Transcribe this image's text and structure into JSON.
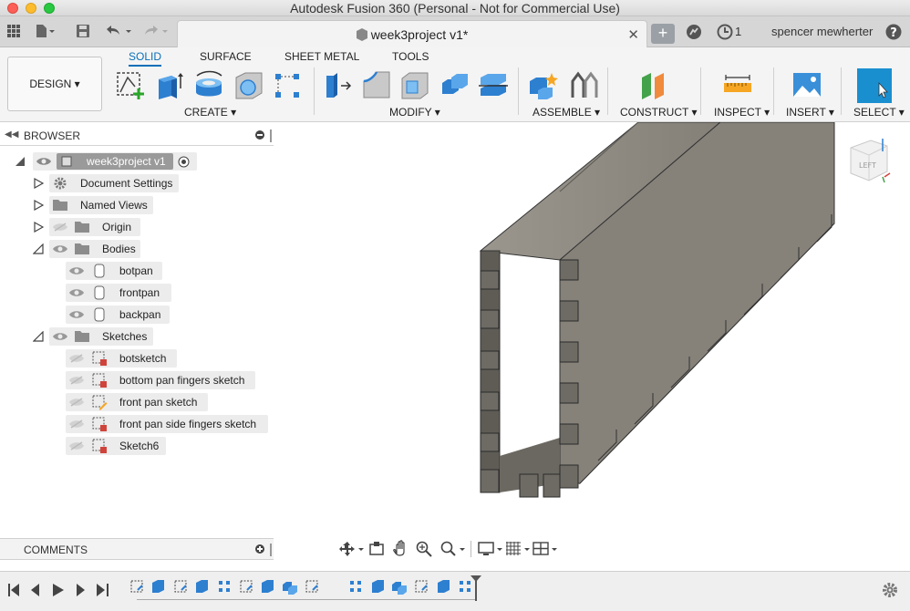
{
  "window": {
    "title": "Autodesk Fusion 360 (Personal - Not for Commercial Use)"
  },
  "tabs": {
    "document_tab": "week3project v1*",
    "job_count": "1",
    "user_name": "spencer mewherter"
  },
  "toolbar": {
    "workspace_button": "DESIGN",
    "workspace_tabs": [
      "SOLID",
      "SURFACE",
      "SHEET METAL",
      "TOOLS"
    ],
    "groups": [
      "CREATE",
      "MODIFY",
      "ASSEMBLE",
      "CONSTRUCT",
      "INSPECT",
      "INSERT",
      "SELECT"
    ]
  },
  "browser": {
    "title": "BROWSER",
    "root": "week3project v1",
    "items": [
      {
        "label": "Document Settings"
      },
      {
        "label": "Named Views"
      },
      {
        "label": "Origin"
      },
      {
        "label": "Bodies"
      },
      {
        "label": "botpan"
      },
      {
        "label": "frontpan"
      },
      {
        "label": "backpan"
      },
      {
        "label": "Sketches"
      },
      {
        "label": "botsketch"
      },
      {
        "label": "bottom pan fingers sketch"
      },
      {
        "label": "front pan sketch"
      },
      {
        "label": "front pan side fingers sketch"
      },
      {
        "label": "Sketch6"
      }
    ]
  },
  "comments": {
    "title": "COMMENTS"
  },
  "viewcube": {
    "face_label": "LEFT"
  },
  "colors": {
    "accent": "#0a6fb8",
    "select_highlight": "#1a8fd0",
    "body_gray": "#8a867e"
  },
  "icons": [
    "grid-icon",
    "file-icon",
    "save-icon",
    "undo-icon",
    "redo-icon",
    "plus-icon",
    "job-status-icon",
    "help-icon",
    "settings-gear-icon"
  ]
}
